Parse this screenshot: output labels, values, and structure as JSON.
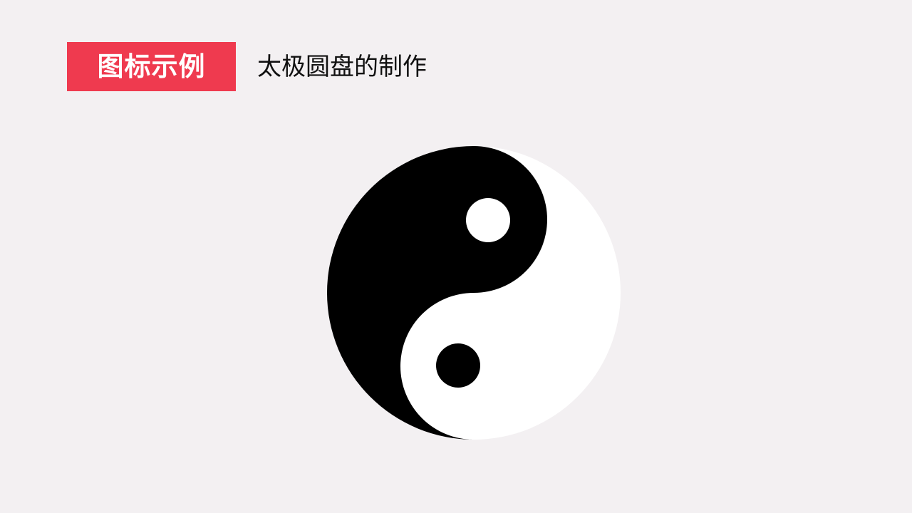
{
  "header": {
    "badge_label": "图标示例",
    "subtitle": "太极圆盘的制作"
  },
  "colors": {
    "background": "#f3f0f2",
    "badge_background": "#ef3a4f",
    "badge_text": "#ffffff",
    "subtitle_text": "#111111",
    "yin": "#000000",
    "yang": "#ffffff"
  },
  "figure": {
    "icon": "yin-yang-icon"
  }
}
